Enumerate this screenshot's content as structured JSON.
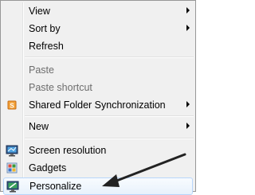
{
  "context_menu": {
    "items": [
      {
        "label": "View"
      },
      {
        "label": "Sort by"
      },
      {
        "label": "Refresh"
      },
      {
        "label": "Paste"
      },
      {
        "label": "Paste shortcut"
      },
      {
        "label": "Shared Folder Synchronization"
      },
      {
        "label": "New"
      },
      {
        "label": "Screen resolution"
      },
      {
        "label": "Gadgets"
      },
      {
        "label": "Personalize"
      }
    ],
    "icons": {
      "shared_folder_sync": "sync-icon",
      "screen_resolution": "monitor-icon",
      "gadgets": "gadgets-icon",
      "personalize": "personalize-icon"
    },
    "colors": {
      "menu_background": "#f0f0f0",
      "menu_border": "#979797",
      "disabled_text": "#6d6d6d",
      "hover_border": "#b8d6fb",
      "annotation_arrow": "#222222"
    }
  }
}
